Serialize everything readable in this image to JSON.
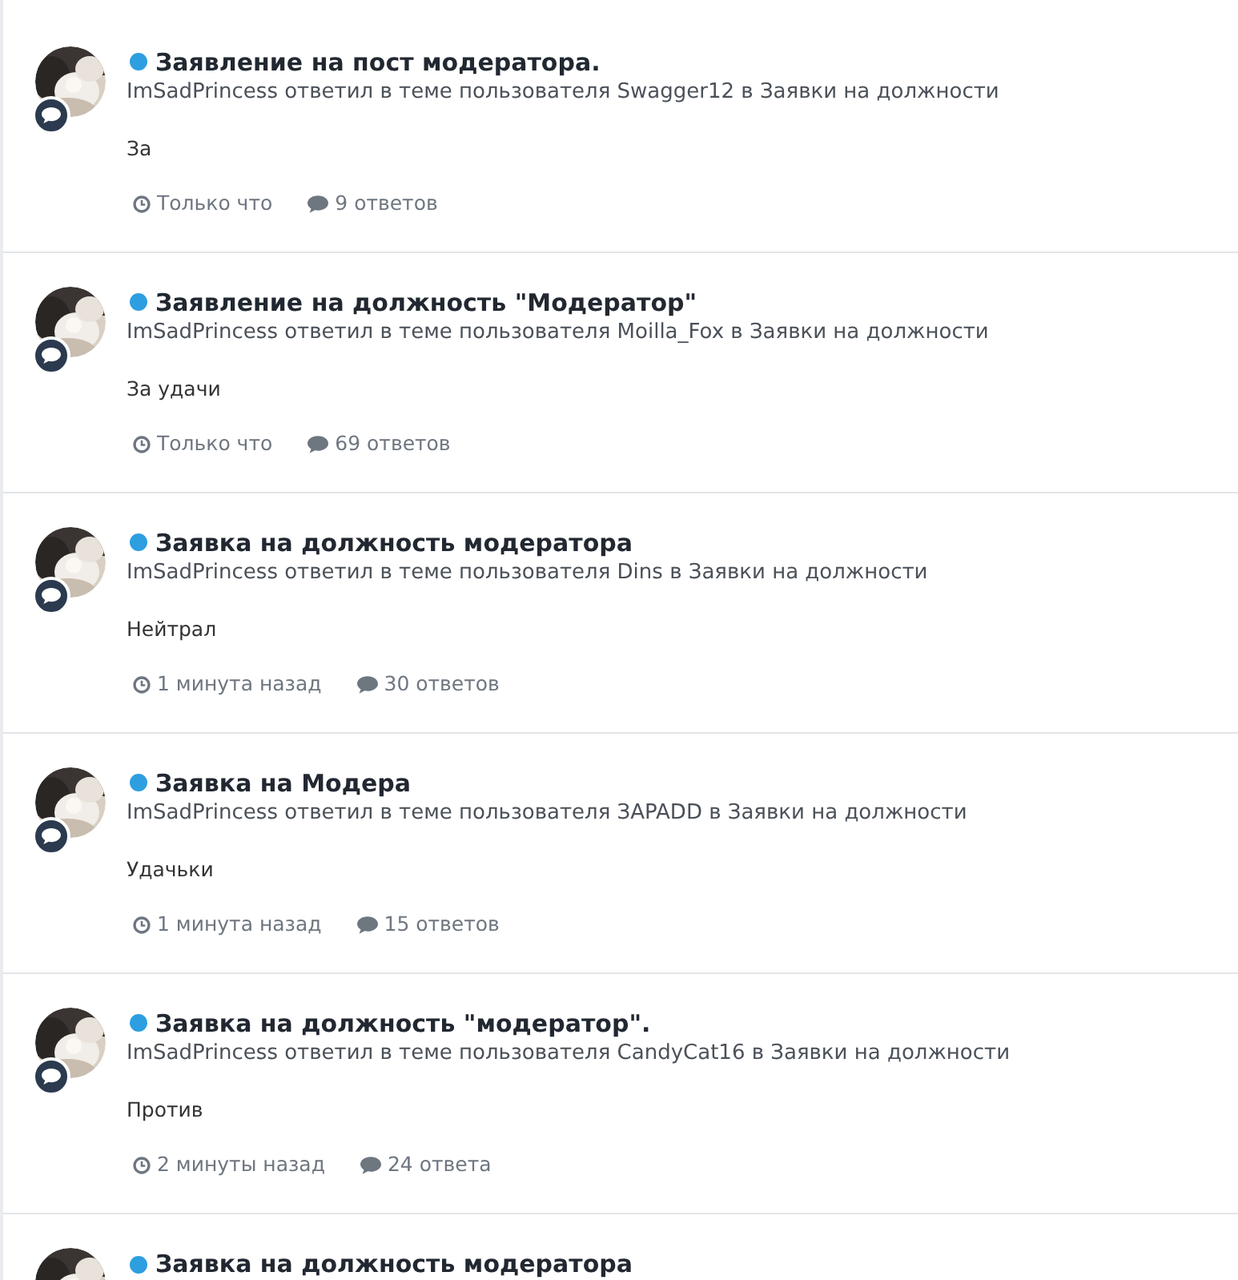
{
  "items": [
    {
      "unread": true,
      "title": "Заявление на пост модератора.",
      "subline": "ImSadPrincess ответил в теме пользователя Swagger12 в Заявки на должности",
      "snippet": "За",
      "time": "Только что",
      "replies": "9 ответов"
    },
    {
      "unread": true,
      "title": "Заявление на должность \"Модератор\"",
      "subline": "ImSadPrincess ответил в теме пользователя Moilla_Fox в Заявки на должности",
      "snippet": "За удачи",
      "time": "Только что",
      "replies": "69 ответов"
    },
    {
      "unread": true,
      "title": "Заявка на должность модератора",
      "subline": "ImSadPrincess ответил в теме пользователя Dins в Заявки на должности",
      "snippet": "Нейтрал",
      "time": "1 минута назад",
      "replies": "30 ответов"
    },
    {
      "unread": true,
      "title": "Заявка на Модера",
      "subline": "ImSadPrincess ответил в теме пользователя ЗAPADD в Заявки на должности",
      "snippet": "Удачьки",
      "time": "1 минута назад",
      "replies": "15 ответов"
    },
    {
      "unread": true,
      "title": "Заявка на должность \"модератор\".",
      "subline": "ImSadPrincess ответил в теме пользователя CandyCat16 в Заявки на должности",
      "snippet": "Против",
      "time": "2 минуты назад",
      "replies": "24 ответа"
    },
    {
      "unread": true,
      "title": "Заявка на должность модератора"
    }
  ]
}
